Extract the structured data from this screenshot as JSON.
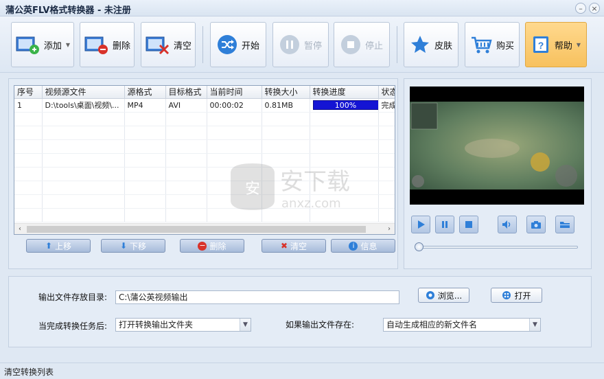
{
  "window": {
    "title": "蒲公英FLV格式转换器 - 未注册"
  },
  "toolbar": {
    "add": "添加",
    "delete": "删除",
    "clear": "清空",
    "start": "开始",
    "pause": "暂停",
    "stop": "停止",
    "skin": "皮肤",
    "buy": "购买",
    "help": "帮助"
  },
  "table": {
    "columns": [
      "序号",
      "视频源文件",
      "源格式",
      "目标格式",
      "当前时间",
      "转换大小",
      "转换进度",
      "状态"
    ],
    "rows": [
      {
        "index": "1",
        "file": "D:\\tools\\桌面\\视频\\...",
        "src_format": "MP4",
        "dst_format": "AVI",
        "time": "00:00:02",
        "size": "0.81MB",
        "progress": "100%",
        "progress_value": 1.0,
        "status": "完成"
      }
    ]
  },
  "list_buttons": {
    "up": "上移",
    "down": "下移",
    "delete": "删除",
    "clear": "清空",
    "info": "信息"
  },
  "watermark": {
    "text": "安下载",
    "sub": "anxz.com"
  },
  "player": {
    "position": 0.0
  },
  "output": {
    "dir_label": "输出文件存放目录:",
    "dir_value": "C:\\蒲公英视频输出",
    "browse": "浏览...",
    "open": "打开",
    "after_label": "当完成转换任务后:",
    "after_value": "打开转换输出文件夹",
    "exists_label": "如果输出文件存在:",
    "exists_value": "自动生成相应的新文件名"
  },
  "status": {
    "text": "清空转换列表"
  },
  "colors": {
    "progress": "#1414d4",
    "help_active": "#f7c15e",
    "accent": "#2f7fd8"
  }
}
